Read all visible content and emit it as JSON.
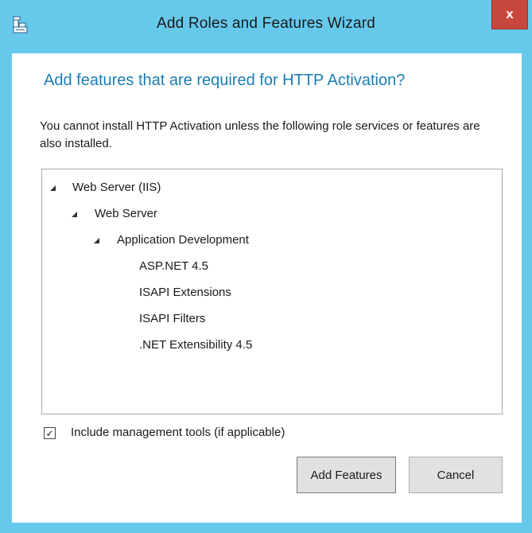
{
  "window": {
    "title": "Add Roles and Features Wizard",
    "close_glyph": "x"
  },
  "dialog": {
    "heading": "Add features that are required for HTTP Activation?",
    "description": "You cannot install HTTP Activation unless the following role services or features are also installed.",
    "tree": [
      {
        "label": "Web Server (IIS)",
        "expanded": true,
        "level": 0
      },
      {
        "label": "Web Server",
        "expanded": true,
        "level": 1
      },
      {
        "label": "Application Development",
        "expanded": true,
        "level": 2
      },
      {
        "label": "ASP.NET 4.5",
        "level": 3
      },
      {
        "label": "ISAPI Extensions",
        "level": 3
      },
      {
        "label": "ISAPI Filters",
        "level": 3
      },
      {
        "label": ".NET Extensibility 4.5",
        "level": 3
      }
    ],
    "include_tools": {
      "label": "Include management tools (if applicable)",
      "checked": true,
      "mark": "✓"
    },
    "buttons": {
      "add": "Add Features",
      "cancel": "Cancel"
    }
  },
  "colors": {
    "frame": "#66c9ec",
    "heading": "#1b7db4",
    "close": "#c7473c"
  },
  "icons": {
    "app": "server-manager-icon",
    "close": "close-icon",
    "expanded": "expanded-triangle-icon"
  }
}
